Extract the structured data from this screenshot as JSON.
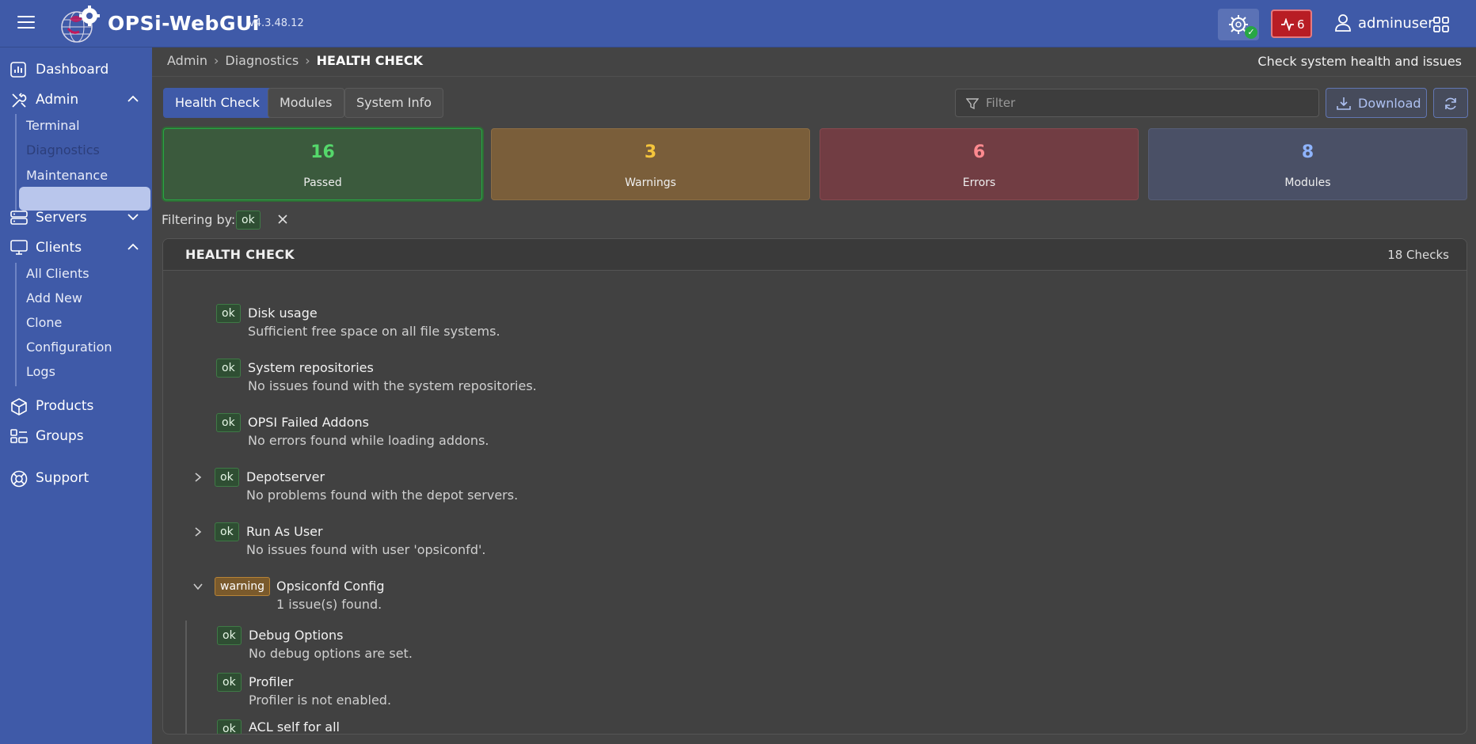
{
  "app": {
    "brand": "OPSi-WebGUi",
    "version": "v4.3.48.12",
    "alert_count": "6",
    "username": "adminuser",
    "colors": {
      "primary": "#3f5aa8",
      "ok": "#27a744",
      "warning": "#b88436",
      "error": "#b81d24"
    }
  },
  "sidebar": {
    "dashboard": "Dashboard",
    "admin": "Admin",
    "admin_items": [
      "Terminal",
      "Diagnostics",
      "Maintenance"
    ],
    "servers": "Servers",
    "clients": "Clients",
    "client_items": [
      "All Clients",
      "Add New",
      "Clone",
      "Configuration",
      "Logs"
    ],
    "products": "Products",
    "groups": "Groups",
    "support": "Support",
    "active_item": "Diagnostics"
  },
  "breadcrumb": [
    "Admin",
    "Diagnostics",
    "HEALTH CHECK"
  ],
  "page_hint": "Check system health and issues",
  "tabs": [
    {
      "label": "Health Check",
      "active": true
    },
    {
      "label": "Modules",
      "active": false
    },
    {
      "label": "System Info",
      "active": false
    }
  ],
  "filter": {
    "placeholder": "Filter",
    "value": ""
  },
  "download_label": "Download",
  "summary": [
    {
      "value": "16",
      "label": "Passed"
    },
    {
      "value": "3",
      "label": "Warnings"
    },
    {
      "value": "6",
      "label": "Errors"
    },
    {
      "value": "8",
      "label": "Modules"
    }
  ],
  "filtering": {
    "label": "Filtering by:",
    "chip": "ok"
  },
  "panel": {
    "title": "HEALTH CHECK",
    "count": "18 Checks"
  },
  "checks": [
    {
      "status": "ok",
      "title": "Disk usage",
      "message": "Sufficient free space on all file systems."
    },
    {
      "status": "ok",
      "title": "System repositories",
      "message": "No issues found with the system repositories."
    },
    {
      "status": "ok",
      "title": "OPSI Failed Addons",
      "message": "No errors found while loading addons."
    },
    {
      "status": "ok",
      "title": "Depotserver",
      "message": "No problems found with the depot servers."
    },
    {
      "status": "ok",
      "title": "Run As User",
      "message": "No issues found with user 'opsiconfd'."
    },
    {
      "status": "warning",
      "title": "Opsiconfd Config",
      "message": "1 issue(s) found."
    }
  ],
  "sub_checks": [
    {
      "status": "ok",
      "title": "Debug Options",
      "message": "No debug options are set."
    },
    {
      "status": "ok",
      "title": "Profiler",
      "message": "Profiler is not enabled."
    },
    {
      "status": "ok",
      "title": "ACL self for all",
      "message": ""
    }
  ]
}
